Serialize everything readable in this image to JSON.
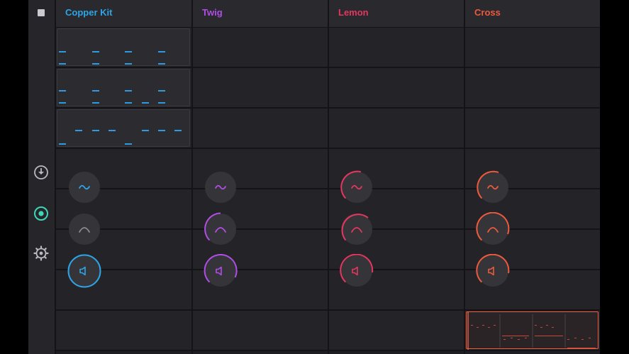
{
  "tracks": [
    {
      "name": "Copper Kit",
      "color": "#2ea5e6"
    },
    {
      "name": "Twig",
      "color": "#b14ee6"
    },
    {
      "name": "Lemon",
      "color": "#e3375f"
    },
    {
      "name": "Cross",
      "color": "#ee5a3d"
    }
  ],
  "sidebar": {
    "icons": [
      "stop-icon",
      "download-icon",
      "record-icon",
      "settings-icon"
    ],
    "active_color": "#3fd6b8"
  },
  "knobs": {
    "rows": [
      "filter-lfo",
      "envelope",
      "volume"
    ]
  }
}
